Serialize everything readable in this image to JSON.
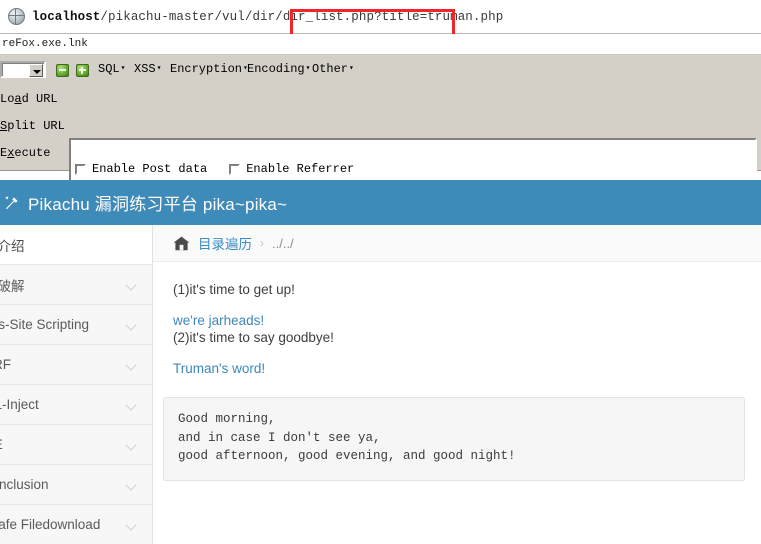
{
  "browser": {
    "globe_icon": "globe-icon",
    "url_host": "localhost",
    "url_path": "/pikachu-master/vul/dir/dir_list.php",
    "url_query": "?title=truman.php",
    "annotation_color": "#f0262b",
    "bookmark_item": "reFox.exe.lnk"
  },
  "hackbar": {
    "icons": {
      "minus": "minus-icon",
      "plus": "plus-icon"
    },
    "menus": [
      {
        "label": "SQL",
        "caret": "▾"
      },
      {
        "label": "XSS",
        "caret": "▾"
      },
      {
        "label": "Encryption",
        "caret": "▾"
      },
      {
        "label": "Encoding",
        "caret": "▾"
      },
      {
        "label": "Other",
        "caret": "▾"
      }
    ],
    "buttons": [
      {
        "pre": "Lo",
        "key": "a",
        "post": "d URL"
      },
      {
        "pre": "",
        "key": "S",
        "post": "plit URL"
      },
      {
        "pre": "E",
        "key": "x",
        "post": "ecute"
      }
    ],
    "url_textarea_value": "",
    "checkboxes": [
      {
        "label": "Enable Post data",
        "checked": false
      },
      {
        "label": "Enable Referrer",
        "checked": false
      }
    ]
  },
  "page": {
    "header": {
      "icon": "pikachu-icon",
      "title": "Pikachu 漏洞练习平台 pika~pika~",
      "background": "#3e8ab8"
    },
    "sidebar": {
      "items": [
        {
          "label": "统介绍",
          "expandable": false,
          "active": true
        },
        {
          "label": "力破解",
          "expandable": true,
          "active": false
        },
        {
          "label": "oss-Site Scripting",
          "expandable": true,
          "active": false
        },
        {
          "label": "SRF",
          "expandable": true,
          "active": false
        },
        {
          "label": "QL-Inject",
          "expandable": true,
          "active": false
        },
        {
          "label": "CE",
          "expandable": true,
          "active": false
        },
        {
          "label": "e Inclusion",
          "expandable": true,
          "active": false
        },
        {
          "label": "nsafe Filedownload",
          "expandable": true,
          "active": false
        }
      ]
    },
    "breadcrumb": {
      "home_icon": "home-icon",
      "link": "目录遍历",
      "separator": "›",
      "current": "../../"
    },
    "main": {
      "line1": "(1)it's time to get up!",
      "link1": "we're jarheads!",
      "line2": "(2)it's time to say goodbye!",
      "link2": "Truman's word!",
      "code": "Good morning,\nand in case I don't see ya,\ngood afternoon, good evening, and good night!"
    }
  }
}
